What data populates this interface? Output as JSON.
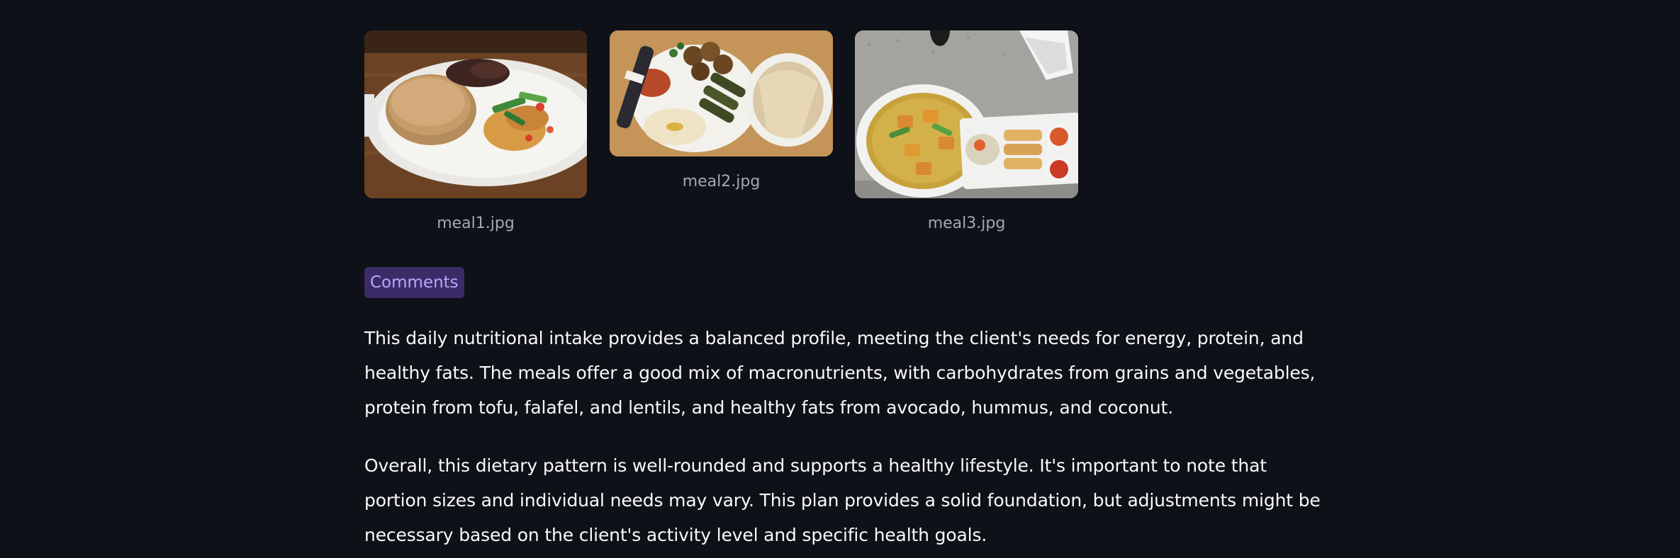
{
  "gallery": {
    "images": [
      {
        "caption": "meal1.jpg"
      },
      {
        "caption": "meal2.jpg"
      },
      {
        "caption": "meal3.jpg"
      }
    ]
  },
  "comments": {
    "badge_label": "Comments",
    "paragraphs": [
      "This daily nutritional intake provides a balanced profile, meeting the client's needs for energy, protein, and healthy fats. The meals offer a good mix of macronutrients, with carbohydrates from grains and vegetables, protein from tofu, falafel, and lentils, and healthy fats from avocado, hummus, and coconut.",
      "Overall, this dietary pattern is well-rounded and supports a healthy lifestyle. It's important to note that portion sizes and individual needs may vary. This plan provides a solid foundation, but adjustments might be necessary based on the client's activity level and specific health goals."
    ]
  },
  "colors": {
    "background": "#0e1117",
    "text": "#fafafa",
    "caption": "#a3a8b4",
    "badge_bg": "#3b2c68",
    "badge_text": "#b9a6ff"
  }
}
